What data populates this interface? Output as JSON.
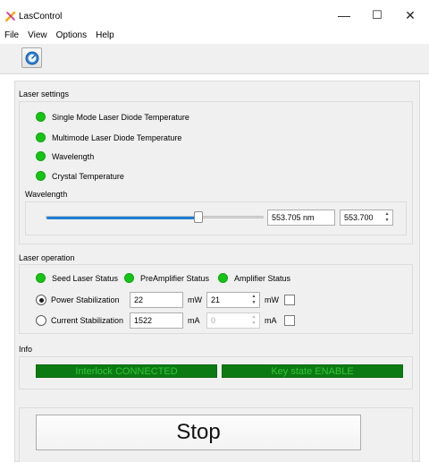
{
  "window": {
    "title": "LasControl",
    "minimize_glyph": "—",
    "maximize_glyph": "☐",
    "close_glyph": "✕",
    "app_icon": "laser-app-icon"
  },
  "menu": [
    "File",
    "View",
    "Options",
    "Help"
  ],
  "toolbar": {
    "icon": "gauge-icon"
  },
  "laser_settings": {
    "title": "Laser settings",
    "indicators": [
      {
        "label": "Single Mode Laser Diode Temperature",
        "color": "#16c416"
      },
      {
        "label": "Multimode Laser Diode Temperature",
        "color": "#16c416"
      },
      {
        "label": "Wavelength",
        "color": "#16c416"
      },
      {
        "label": "Crystal Temperature",
        "color": "#16c416"
      }
    ],
    "wavelength_label": "Wavelength",
    "slider_fraction": 0.7,
    "wavelength_readout": "553.705 nm",
    "wavelength_setpoint": "553.700"
  },
  "laser_operation": {
    "title": "Laser operation",
    "statuses": [
      {
        "label": "Seed Laser Status",
        "color": "#16c416"
      },
      {
        "label": "PreAmplifier Status",
        "color": "#16c416"
      },
      {
        "label": "Amplifier Status",
        "color": "#16c416"
      }
    ],
    "power": {
      "label": "Power Stabilization",
      "selected": true,
      "value": "22",
      "unit": "mW",
      "setpoint": "21",
      "setpoint_unit": "mW",
      "checked": false
    },
    "current": {
      "label": "Current Stabilization",
      "selected": false,
      "value": "1522",
      "unit": "mA",
      "setpoint": "0",
      "setpoint_unit": "mA",
      "checked": false
    }
  },
  "info": {
    "title": "Info",
    "interlock": "Interlock CONNECTED",
    "key_state": "Key state ENABLE",
    "bar_color": "#0c7a12"
  },
  "stop_button": "Stop"
}
